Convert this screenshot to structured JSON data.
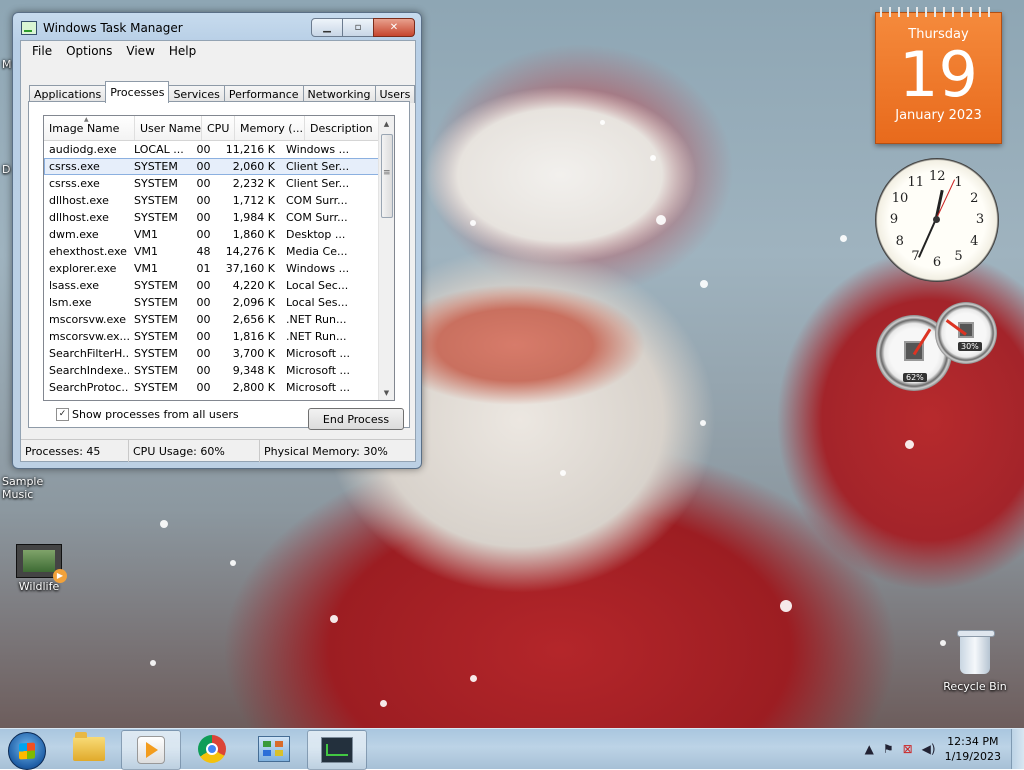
{
  "task_manager": {
    "title": "Windows Task Manager",
    "menu": [
      "File",
      "Options",
      "View",
      "Help"
    ],
    "tabs": [
      "Applications",
      "Processes",
      "Services",
      "Performance",
      "Networking",
      "Users"
    ],
    "active_tab": "Processes",
    "columns": [
      "Image Name",
      "User Name",
      "CPU",
      "Memory (...",
      "Description"
    ],
    "rows": [
      [
        "audiodg.exe",
        "LOCAL ...",
        "00",
        "11,216 K",
        "Windows ..."
      ],
      [
        "csrss.exe",
        "SYSTEM",
        "00",
        "2,060 K",
        "Client Ser..."
      ],
      [
        "csrss.exe",
        "SYSTEM",
        "00",
        "2,232 K",
        "Client Ser..."
      ],
      [
        "dllhost.exe",
        "SYSTEM",
        "00",
        "1,712 K",
        "COM Surr..."
      ],
      [
        "dllhost.exe",
        "SYSTEM",
        "00",
        "1,984 K",
        "COM Surr..."
      ],
      [
        "dwm.exe",
        "VM1",
        "00",
        "1,860 K",
        "Desktop ..."
      ],
      [
        "ehexthost.exe",
        "VM1",
        "48",
        "14,276 K",
        "Media Ce..."
      ],
      [
        "explorer.exe",
        "VM1",
        "01",
        "37,160 K",
        "Windows ..."
      ],
      [
        "lsass.exe",
        "SYSTEM",
        "00",
        "4,220 K",
        "Local Sec..."
      ],
      [
        "lsm.exe",
        "SYSTEM",
        "00",
        "2,096 K",
        "Local Ses..."
      ],
      [
        "mscorsvw.exe",
        "SYSTEM",
        "00",
        "2,656 K",
        ".NET Run..."
      ],
      [
        "mscorsvw.ex...",
        "SYSTEM",
        "00",
        "1,816 K",
        ".NET Run..."
      ],
      [
        "SearchFilterH...",
        "SYSTEM",
        "00",
        "3,700 K",
        "Microsoft ..."
      ],
      [
        "SearchIndexe...",
        "SYSTEM",
        "00",
        "9,348 K",
        "Microsoft ..."
      ],
      [
        "SearchProtoc...",
        "SYSTEM",
        "00",
        "2,800 K",
        "Microsoft ..."
      ]
    ],
    "selected_row": 1,
    "show_all_users_label": "Show processes from all users",
    "show_all_users_checked": true,
    "end_process_label": "End Process",
    "status": {
      "processes": "Processes: 45",
      "cpu": "CPU Usage: 60%",
      "memory": "Physical Memory: 30%"
    }
  },
  "desktop_icons": {
    "sample_music": "Sample Music",
    "wildlife": "Wildlife",
    "recycle_bin": "Recycle Bin",
    "left_edge_letters": [
      "M",
      "D"
    ]
  },
  "calendar_gadget": {
    "day_of_week": "Thursday",
    "day": "19",
    "month_year": "January 2023",
    "color": "#f0782a"
  },
  "clock_gadget": {
    "numbers": [
      "12",
      "1",
      "2",
      "3",
      "4",
      "5",
      "6",
      "7",
      "8",
      "9",
      "10",
      "11"
    ]
  },
  "cpu_meter_gadget": {
    "cpu_label": "62%",
    "memory_label": "30%",
    "cpu_value": 0.62,
    "memory_value": 0.3
  },
  "taskbar": {
    "time": "12:34 PM",
    "date": "1/19/2023",
    "buttons": [
      "start-button",
      "explorer",
      "media-player",
      "chrome",
      "control-panel",
      "task-manager"
    ]
  }
}
